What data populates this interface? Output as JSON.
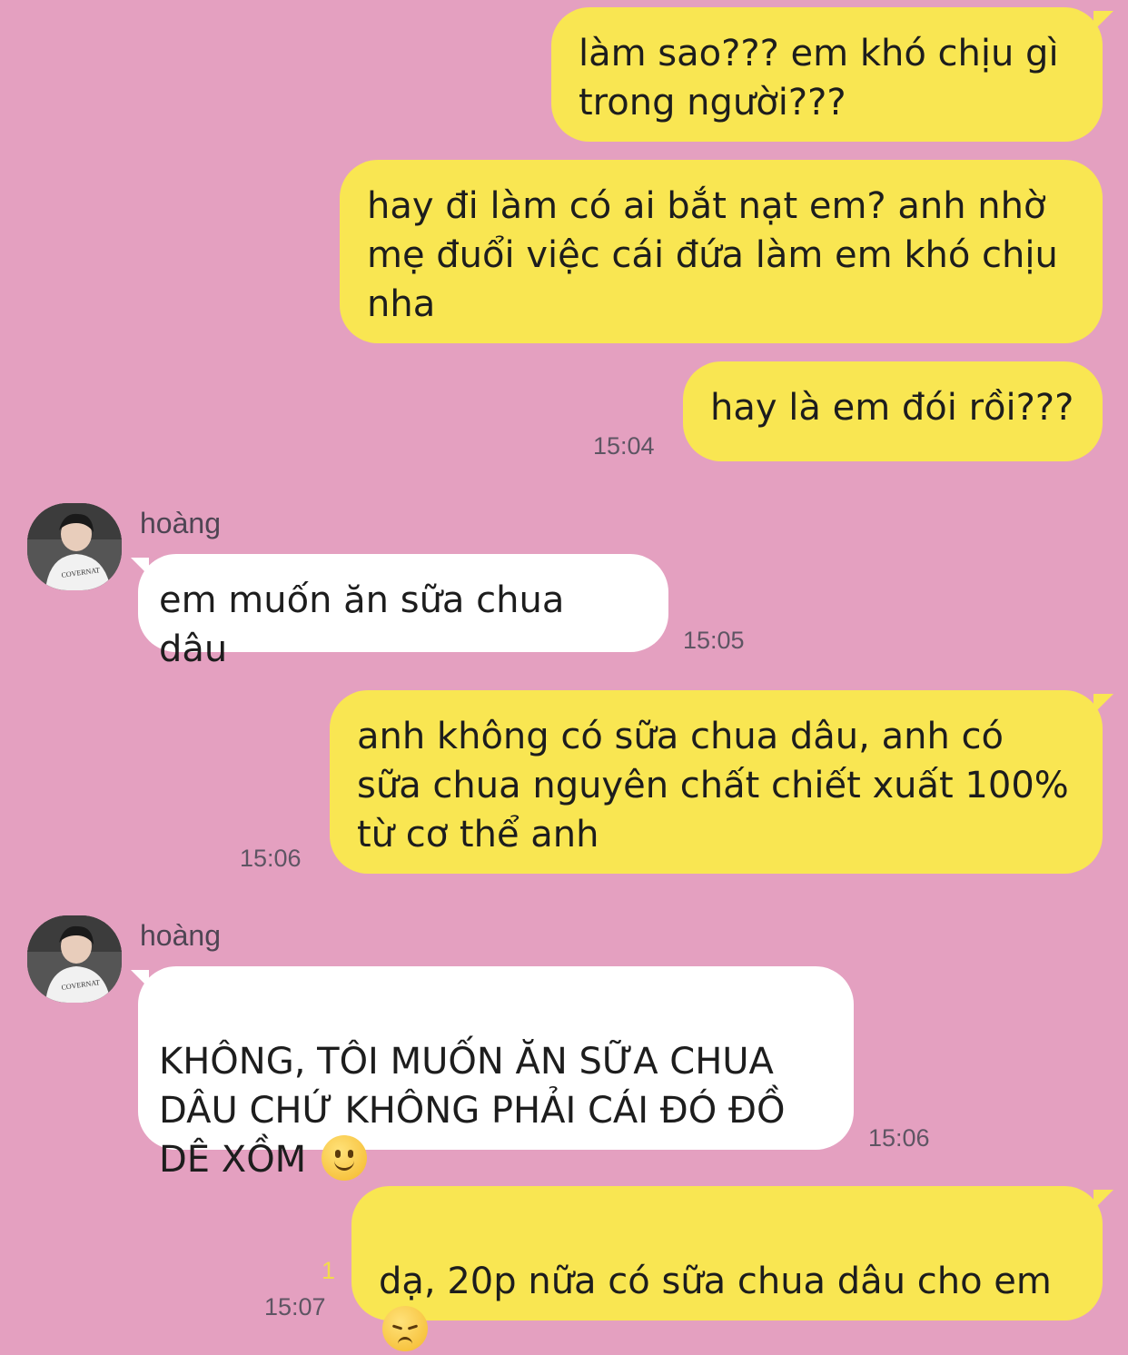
{
  "contact": {
    "name": "hoàng"
  },
  "messages": [
    {
      "side": "out",
      "text": "làm sao??? em khó chịu gì\ntrong người???",
      "time": ""
    },
    {
      "side": "out",
      "text": "hay đi làm có ai bắt nạt em? anh nhờ\nmẹ đuổi việc cái đứa làm em khó chịu\nnha",
      "time": ""
    },
    {
      "side": "out",
      "text": "hay là em đói rồi???",
      "time": "15:04"
    },
    {
      "side": "in",
      "sender": "hoàng",
      "text": "em muốn ăn sữa chua dâu",
      "time": "15:05"
    },
    {
      "side": "out",
      "text": "anh không có sữa chua dâu, anh có\nsữa chua nguyên chất chiết xuất 100%\ntừ cơ thể anh",
      "time": "15:06"
    },
    {
      "side": "in",
      "sender": "hoàng",
      "text": "KHÔNG, TÔI MUỐN ĂN SỮA CHUA\nDÂU CHỨ KHÔNG PHẢI CÁI ĐÓ ĐỒ\nDÊ XỒM ",
      "emoji": "slightly-smiling-face",
      "time": "15:06"
    },
    {
      "side": "out",
      "text": "dạ, 20p nữa có sữa chua dâu cho em\n",
      "emoji": "pensive-face",
      "time": "15:07",
      "read_count": "1"
    }
  ],
  "avatar_shirt_text": "COVERNAT",
  "colors": {
    "background": "#e4a0c0",
    "outgoing_bubble": "#f9e652",
    "incoming_bubble": "#ffffff",
    "timestamp": "#5e5563",
    "read_count": "#f2dc4a"
  }
}
